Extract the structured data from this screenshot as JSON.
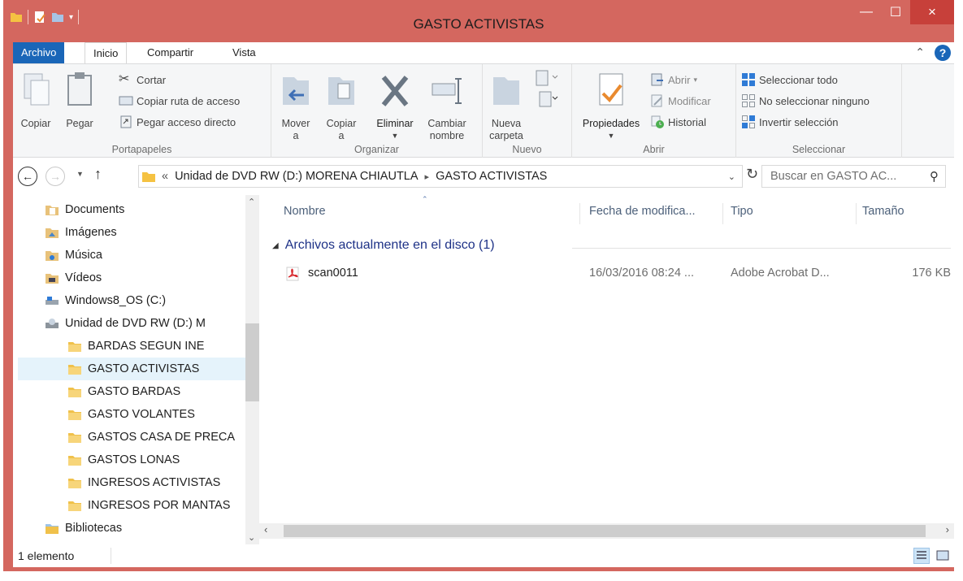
{
  "window": {
    "title": "GASTO ACTIVISTAS",
    "accent_color": "#d4675f",
    "close_symbol": "×",
    "minimize_symbol": "—",
    "maximize_symbol": "☐"
  },
  "ribbon_tabs": {
    "file": "Archivo",
    "inicio": "Inicio",
    "compartir": "Compartir",
    "vista": "Vista"
  },
  "ribbon": {
    "portapapeles": {
      "label": "Portapapeles",
      "copiar": "Copiar",
      "pegar": "Pegar",
      "cortar": "Cortar",
      "copiar_ruta": "Copiar ruta de acceso",
      "pegar_acceso": "Pegar acceso directo"
    },
    "organizar": {
      "label": "Organizar",
      "mover_1": "Mover",
      "mover_2": "a",
      "copiar_1": "Copiar",
      "copiar_2": "a",
      "eliminar": "Eliminar",
      "cambiar_1": "Cambiar",
      "cambiar_2": "nombre"
    },
    "nuevo": {
      "label": "Nuevo",
      "nueva_1": "Nueva",
      "nueva_2": "carpeta"
    },
    "abrir": {
      "label": "Abrir",
      "propiedades": "Propiedades",
      "abrir": "Abrir",
      "modificar": "Modificar",
      "historial": "Historial"
    },
    "seleccionar": {
      "label": "Seleccionar",
      "todo": "Seleccionar todo",
      "ninguno": "No seleccionar ninguno",
      "invertir": "Invertir selección"
    }
  },
  "address": {
    "prefix": "«",
    "segment_1": "Unidad de DVD RW (D:) MORENA CHIAUTLA",
    "separator": "▸",
    "segment_2": "GASTO ACTIVISTAS",
    "search_placeholder": "Buscar en GASTO AC..."
  },
  "nav_pane": {
    "items": [
      {
        "label": "Documents"
      },
      {
        "label": "Imágenes"
      },
      {
        "label": "Música"
      },
      {
        "label": "Vídeos"
      },
      {
        "label": "Windows8_OS (C:)"
      },
      {
        "label": "Unidad de DVD RW (D:) M"
      },
      {
        "label": "BARDAS SEGUN INE"
      },
      {
        "label": "GASTO ACTIVISTAS"
      },
      {
        "label": "GASTO BARDAS"
      },
      {
        "label": "GASTO VOLANTES"
      },
      {
        "label": "GASTOS CASA DE PRECA"
      },
      {
        "label": "GASTOS LONAS"
      },
      {
        "label": "INGRESOS ACTIVISTAS"
      },
      {
        "label": "INGRESOS POR MANTAS"
      },
      {
        "label": "Bibliotecas"
      }
    ]
  },
  "file_list": {
    "columns": {
      "nombre": "Nombre",
      "fecha": "Fecha de modifica...",
      "tipo": "Tipo",
      "tamano": "Tamaño"
    },
    "group_header": "Archivos actualmente en el disco (1)",
    "rows": [
      {
        "name": "scan0011",
        "date": "16/03/2016 08:24 ...",
        "type": "Adobe Acrobat D...",
        "size": "176 KB"
      }
    ]
  },
  "status": {
    "count": "1 elemento"
  }
}
